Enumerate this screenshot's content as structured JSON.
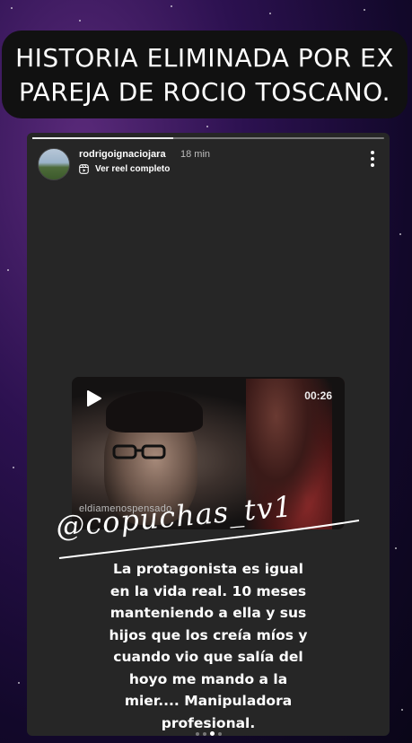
{
  "headline": {
    "line1": "HISTORIA ELIMINADA POR EX",
    "line2": "PAREJA DE ROCIO TOSCANO."
  },
  "story": {
    "username": "rodrigoignaciojara",
    "time_ago": "18 min",
    "reel_link": "Ver reel completo",
    "more_icon": "more-vertical-icon",
    "progress": 0.4,
    "video": {
      "duration": "00:26",
      "watermark": "eldiamenospensado",
      "play_icon": "play-icon"
    },
    "signature": "@copuchas_tv1",
    "caption_lines": [
      "La protagonista es igual",
      "en la vida real. 10 meses",
      "manteniendo a ella y sus",
      "hijos que los creía míos y",
      "cuando vio que salía del",
      "hoyo me mando a la",
      "mier.... Manipuladora",
      "profesional."
    ],
    "pager": {
      "count": 4,
      "active": 2
    }
  },
  "colors": {
    "background": "#2c1150",
    "story_bg": "#262626",
    "headline_bg": "#111111",
    "text": "#ffffff"
  }
}
